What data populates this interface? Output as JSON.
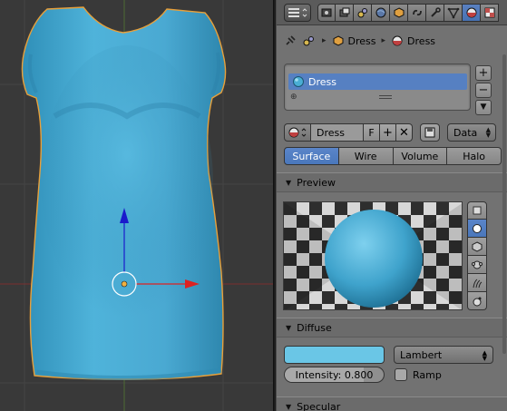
{
  "viewport": {
    "bg_color": "#393939",
    "grid_color": "#444444",
    "axis_x_color": "#cc3333",
    "axis_y_color": "#1a1acc",
    "object_color": "#4aaed4",
    "outline_color": "#e8a03a"
  },
  "header": {
    "editor_icon": "properties-editor-icon",
    "context_tabs": [
      {
        "name": "render-icon",
        "active": false
      },
      {
        "name": "render-layers-icon",
        "active": false
      },
      {
        "name": "scene-icon",
        "active": false
      },
      {
        "name": "world-icon",
        "active": false
      },
      {
        "name": "object-icon",
        "active": false
      },
      {
        "name": "constraints-icon",
        "active": false
      },
      {
        "name": "modifiers-icon",
        "active": false
      },
      {
        "name": "object-data-icon",
        "active": false
      },
      {
        "name": "material-icon",
        "active": true
      },
      {
        "name": "texture-icon",
        "active": false
      }
    ]
  },
  "breadcrumb": {
    "object": "Dress",
    "material": "Dress"
  },
  "slots": {
    "items": [
      {
        "label": "Dress",
        "active": true
      }
    ]
  },
  "material": {
    "name": "Dress",
    "fake_user": "F",
    "link": "Data"
  },
  "tabs": [
    {
      "label": "Surface",
      "active": true
    },
    {
      "label": "Wire",
      "active": false
    },
    {
      "label": "Volume",
      "active": false
    },
    {
      "label": "Halo",
      "active": false
    }
  ],
  "panels": {
    "preview": "Preview",
    "diffuse": "Diffuse",
    "specular": "Specular"
  },
  "diffuse": {
    "color": "#6ac6e6",
    "shader": "Lambert",
    "intensity_label": "Intensity: 0.800",
    "intensity_value": 0.8,
    "ramp_label": "Ramp"
  }
}
